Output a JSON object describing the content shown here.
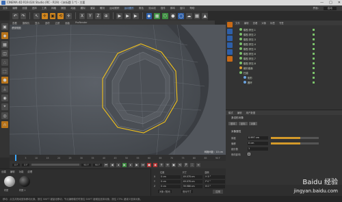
{
  "window": {
    "title": "CINEMA 4D R19.024 Studio (RC - R19) - [未标题 1 *] - 主要",
    "controls": [
      "—",
      "□",
      "✕"
    ]
  },
  "menubar": {
    "items": [
      "文件",
      "编辑",
      "创建",
      "选择",
      "工具",
      "网格",
      "捕捉",
      "动画",
      "模拟",
      "渲染",
      "雕刻",
      "运动跟踪",
      "运动图形",
      "角色",
      "流水线",
      "插件",
      "脚本",
      "窗口",
      "帮助"
    ],
    "layout_label": "界面:",
    "layout_value": "启动"
  },
  "toolbar": {
    "buttons": [
      "↶",
      "↷",
      "↖",
      "✛",
      "▣",
      "⟲",
      "✛",
      "X",
      "Y",
      "Z",
      "⊕",
      "▶",
      "▶",
      "▶",
      "◆",
      "▦",
      "⬡",
      "●",
      "◯",
      "☁",
      "▦",
      "▲",
      "♦",
      "✱",
      "▤",
      "⚡",
      "◐",
      "◑",
      "☼"
    ]
  },
  "viewport": {
    "menu": [
      "查看",
      "摄像机",
      "显示",
      "选项",
      "过滤",
      "面板",
      "ProRender"
    ],
    "label": "透视视图",
    "distance": "网格间距 : 10 cm"
  },
  "object_manager": {
    "menu": [
      "文件",
      "编辑",
      "查看",
      "对象",
      "标签",
      "书签"
    ],
    "rows": [
      "模型.挤压.1",
      "模型.挤压.2",
      "模型.挤压.3",
      "模型.挤压.4",
      "模型.挤压.5",
      "模型.挤压.6",
      "模型.挤压.7",
      "模型.挤压.8",
      "细分曲面",
      "扫描",
      "矩形",
      "圆环"
    ]
  },
  "attribute_manager": {
    "menu": [
      "模式",
      "编辑",
      "用户数据"
    ],
    "object_label": "多边形对象",
    "tabs": [
      "基本",
      "坐标",
      "对象"
    ],
    "section": "对象属性",
    "rows": [
      {
        "label": "厚度",
        "value": "0.997 cm",
        "fill": 0.62
      },
      {
        "label": "偏移",
        "value": "0 cm",
        "fill": 0.62
      },
      {
        "label": "细分数",
        "value": "1",
        "fill": 0.0
      },
      {
        "label": "修改影响",
        "value": "",
        "fill": 0.0
      }
    ]
  },
  "timeline": {
    "ticks": [
      "0",
      "5",
      "10",
      "15",
      "20",
      "25",
      "30",
      "35",
      "40",
      "45",
      "50",
      "55",
      "60",
      "65",
      "70",
      "75",
      "80",
      "85",
      "90 F"
    ],
    "current_frame": "0 F",
    "start": "0 F",
    "end": "90 F",
    "end2": "90 F"
  },
  "material": {
    "menu": [
      "创建",
      "编辑",
      "功能",
      "纹理"
    ],
    "items": [
      "材质",
      "材质.1"
    ]
  },
  "coordinates": {
    "headers": [
      "位置",
      "尺寸",
      "旋转"
    ],
    "rows": [
      {
        "axis": "X",
        "pos": "0 cm",
        "size": "49.078 cm",
        "rot": "H 0 °"
      },
      {
        "axis": "Y",
        "pos": "0 cm",
        "size": "49.078 cm",
        "rot": "P 0 °"
      },
      {
        "axis": "Z",
        "pos": "0 cm",
        "size": "39.986 cm",
        "rot": "B 0 °"
      }
    ],
    "mode_left": "对象 (相对)",
    "mode_right": "绝对尺寸",
    "apply": "应用"
  },
  "status": {
    "text": "移动：点击并拖动鼠标移动元素。按住 SHIFT 键量化移动；节点编辑模式时按住 SHIFT 键增加选择对象；按住 CTRL 键减少选择对象。"
  },
  "watermark": {
    "brand": "Baidu 经验",
    "url": "jingyan.baidu.com"
  },
  "colors": {
    "accent": "#d0851d",
    "selection": "#f2c21b",
    "blue": "#2e5fa8"
  }
}
